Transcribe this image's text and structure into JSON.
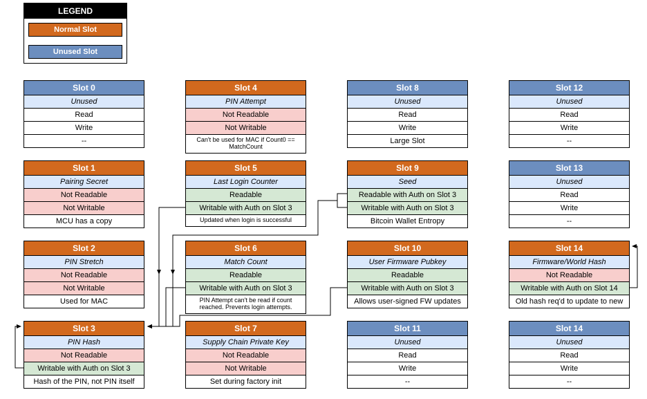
{
  "legend": {
    "title": "LEGEND",
    "normal": "Normal Slot",
    "unused": "Unused Slot"
  },
  "slots": {
    "s0": {
      "title": "Slot 0",
      "type": "unused",
      "sub": "Unused",
      "r1": "Read",
      "r2": "Write",
      "r3": "--"
    },
    "s1": {
      "title": "Slot 1",
      "type": "normal",
      "sub": "Pairing Secret",
      "r1": "Not Readable",
      "r2": "Not Writable",
      "r3": "MCU has a copy"
    },
    "s2": {
      "title": "Slot 2",
      "type": "normal",
      "sub": "PIN Stretch",
      "r1": "Not Readable",
      "r2": "Not Writable",
      "r3": "Used for MAC"
    },
    "s3": {
      "title": "Slot 3",
      "type": "normal",
      "sub": "PIN Hash",
      "r1": "Not Readable",
      "r2": "Writable with Auth on Slot 3",
      "r3": "Hash of the PIN, not PIN itself"
    },
    "s4": {
      "title": "Slot 4",
      "type": "normal",
      "sub": "PIN Attempt",
      "r1": "Not Readable",
      "r2": "Not Writable",
      "r3": "Can't be used for MAC if Count0 == MatchCount"
    },
    "s5": {
      "title": "Slot 5",
      "type": "normal",
      "sub": "Last Login Counter",
      "r1": "Readable",
      "r2": "Writable with Auth on Slot 3",
      "r3": "Updated when login is successful"
    },
    "s6": {
      "title": "Slot 6",
      "type": "normal",
      "sub": "Match Count",
      "r1": "Readable",
      "r2": "Writable with Auth on Slot 3",
      "r3": "PIN Attempt can't be read if count reached.  Prevents login attempts."
    },
    "s7": {
      "title": "Slot 7",
      "type": "normal",
      "sub": "Supply Chain Private Key",
      "r1": "Not Readable",
      "r2": "Not Writable",
      "r3": "Set during factory init"
    },
    "s8": {
      "title": "Slot 8",
      "type": "unused",
      "sub": "Unused",
      "r1": "Read",
      "r2": "Write",
      "r3": "Large Slot"
    },
    "s9": {
      "title": "Slot 9",
      "type": "normal",
      "sub": "Seed",
      "r1": "Readable with Auth on Slot 3",
      "r2": "Writable with Auth on Slot 3",
      "r3": "Bitcoin Wallet Entropy"
    },
    "s10": {
      "title": "Slot 10",
      "type": "normal",
      "sub": "User Firmware Pubkey",
      "r1": "Readable",
      "r2": "Writable with Auth on Slot 3",
      "r3": "Allows user-signed FW updates"
    },
    "s11": {
      "title": "Slot 11",
      "type": "unused",
      "sub": "Unused",
      "r1": "Read",
      "r2": "Write",
      "r3": "--"
    },
    "s12": {
      "title": "Slot 12",
      "type": "unused",
      "sub": "Unused",
      "r1": "Read",
      "r2": "Write",
      "r3": "--"
    },
    "s13": {
      "title": "Slot 13",
      "type": "unused",
      "sub": "Unused",
      "r1": "Read",
      "r2": "Write",
      "r3": "--"
    },
    "s14": {
      "title": "Slot 14",
      "type": "normal",
      "sub": "Firmware/World Hash",
      "r1": "Not Readable",
      "r2": "Writable with Auth on Slot 14",
      "r3": "Old hash req'd to update to new"
    },
    "s15": {
      "title": "Slot 14",
      "type": "unused",
      "sub": "Unused",
      "r1": "Read",
      "r2": "Write",
      "r3": "--"
    }
  }
}
